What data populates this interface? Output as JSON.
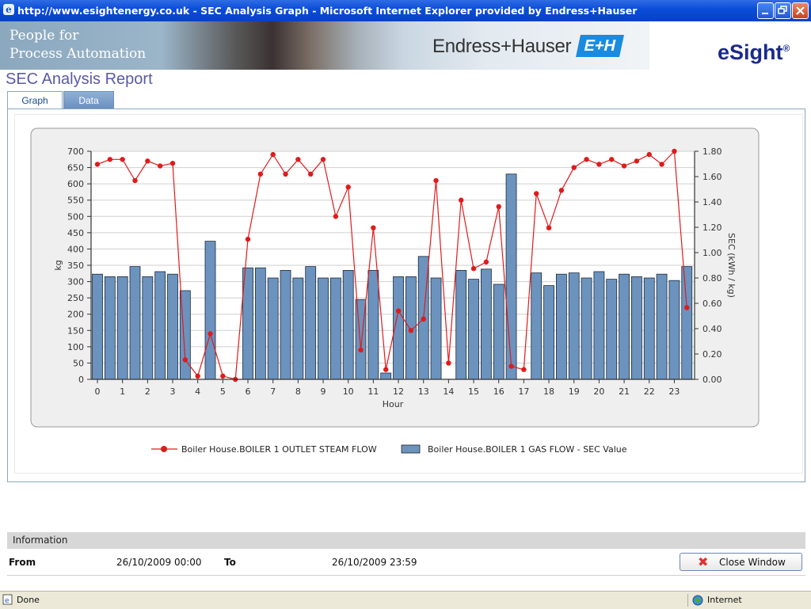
{
  "window": {
    "title": "http://www.esightenergy.co.uk - SEC Analysis Graph - Microsoft Internet Explorer provided by Endress+Hauser"
  },
  "banner": {
    "tagline_line1": "People for",
    "tagline_line2": "Process Automation",
    "company": "Endress+Hauser",
    "company_mark": "E+H",
    "product": "eSight",
    "product_reg": "®"
  },
  "report": {
    "title": "SEC Analysis Report"
  },
  "tabs": [
    {
      "label": "Graph",
      "active": true
    },
    {
      "label": "Data",
      "active": false
    }
  ],
  "chart_data": {
    "type": "bar",
    "xlabel": "Hour",
    "ylabel": "kg",
    "y2label": "SEC (kWh / kg)",
    "ylim": [
      0,
      700
    ],
    "y2lim": [
      0,
      1.8
    ],
    "yticks": [
      0,
      50,
      100,
      150,
      200,
      250,
      300,
      350,
      400,
      450,
      500,
      550,
      600,
      650,
      700
    ],
    "y2ticks": [
      "0.00",
      "0.20",
      "0.40",
      "0.60",
      "0.80",
      "1.00",
      "1.20",
      "1.40",
      "1.60",
      "1.80"
    ],
    "xticks": [
      "0",
      "1",
      "2",
      "3",
      "4",
      "5",
      "6",
      "7",
      "8",
      "9",
      "10",
      "11",
      "12",
      "13",
      "14",
      "15",
      "16",
      "17",
      "18",
      "19",
      "20",
      "21",
      "22",
      "23"
    ],
    "x": [
      0,
      0.5,
      1,
      1.5,
      2,
      2.5,
      3,
      3.5,
      4,
      4.5,
      5,
      5.5,
      6,
      6.5,
      7,
      7.5,
      8,
      8.5,
      9,
      9.5,
      10,
      10.5,
      11,
      11.5,
      12,
      12.5,
      13,
      13.5,
      14,
      14.5,
      15,
      15.5,
      16,
      16.5,
      17,
      17.5,
      18,
      18.5,
      19,
      19.5,
      20,
      20.5,
      21,
      21.5,
      22,
      22.5,
      23,
      23.5
    ],
    "series": [
      {
        "name": "Boiler House.BOILER 1 GAS FLOW - SEC Value",
        "type": "bar",
        "axis": "right",
        "color": "#6b93be",
        "values": [
          0.83,
          0.81,
          0.81,
          0.89,
          0.81,
          0.85,
          0.83,
          0.7,
          0,
          1.09,
          0,
          0,
          0.88,
          0.88,
          0.8,
          0.86,
          0.8,
          0.89,
          0.8,
          0.8,
          0.86,
          0.63,
          0.86,
          0.05,
          0.81,
          0.81,
          0.97,
          0.8,
          0,
          0.86,
          0.79,
          0.87,
          0.75,
          1.62,
          0,
          0.84,
          0.74,
          0.83,
          0.84,
          0.8,
          0.85,
          0.79,
          0.83,
          0.81,
          0.8,
          0.83,
          0.78,
          0.89
        ]
      },
      {
        "name": "Boiler House.BOILER 1 OUTLET STEAM FLOW",
        "type": "line",
        "axis": "left",
        "color": "#e01b1b",
        "values": [
          660,
          675,
          675,
          610,
          670,
          655,
          663,
          60,
          10,
          140,
          10,
          0,
          430,
          630,
          690,
          630,
          675,
          630,
          675,
          500,
          590,
          90,
          465,
          30,
          210,
          150,
          185,
          610,
          50,
          550,
          340,
          360,
          530,
          40,
          30,
          570,
          465,
          580,
          650,
          675,
          660,
          675,
          655,
          670,
          690,
          660,
          700,
          220
        ]
      }
    ],
    "legend_position": "bottom",
    "grid": true
  },
  "info": {
    "header": "Information",
    "from_label": "From",
    "from_value": "26/10/2009 00:00",
    "to_label": "To",
    "to_value": "26/10/2009 23:59",
    "close_label": "Close Window"
  },
  "status": {
    "left": "Done",
    "zone": "Internet"
  }
}
